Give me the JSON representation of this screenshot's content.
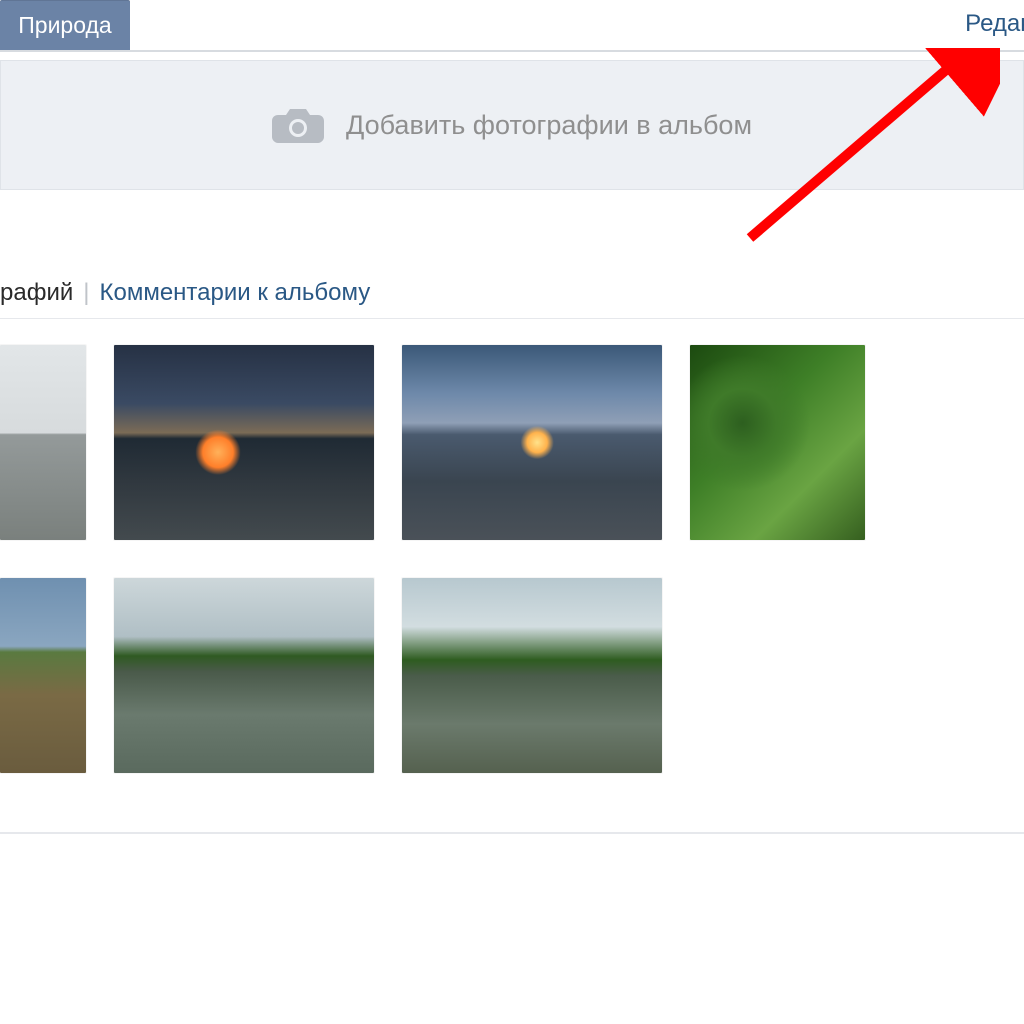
{
  "header": {
    "active_tab": "Природа",
    "edit_link": "Редакт"
  },
  "add_box": {
    "icon": "camera-icon",
    "label": "Добавить фотографии в альбом"
  },
  "subheader": {
    "photos_tab": "рафий",
    "separator": "|",
    "comments_tab": "Комментарии к альбому"
  },
  "annotation": {
    "arrow_color": "#ff0000"
  }
}
